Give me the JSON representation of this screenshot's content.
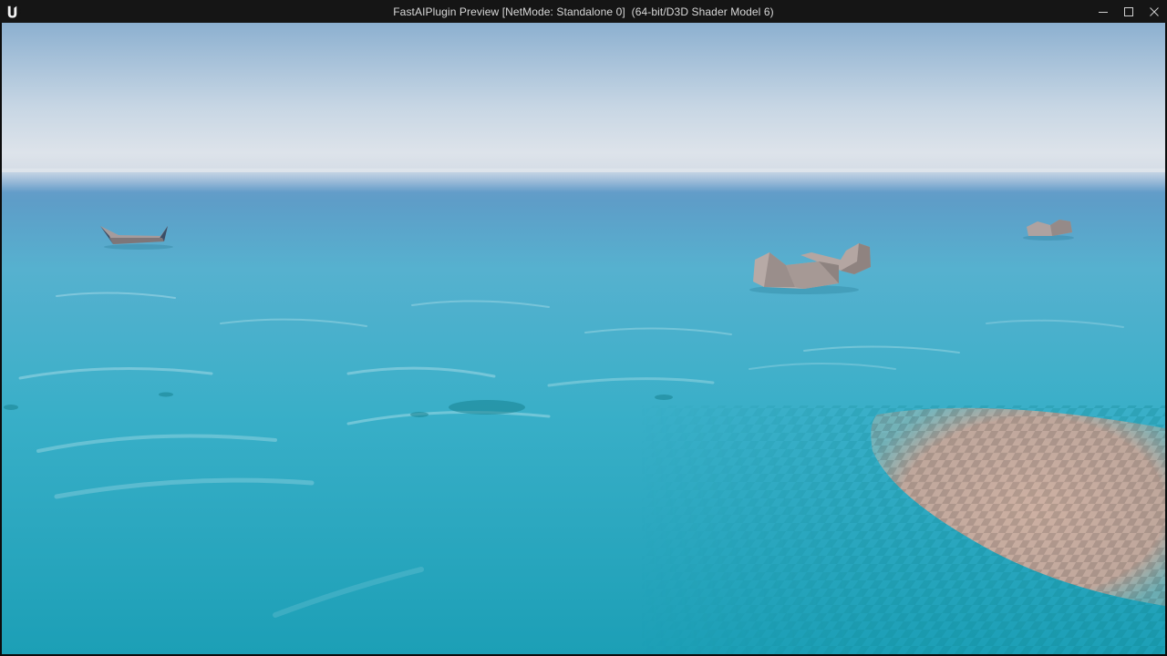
{
  "window": {
    "title": "FastAIPlugin Preview [NetMode: Standalone 0]  (64-bit/D3D Shader Model 6)",
    "app_icon": "unreal-engine-logo",
    "controls": {
      "minimize": "minimize-icon",
      "maximize": "maximize-icon",
      "close": "close-icon"
    }
  },
  "scene": {
    "description_type": "3d-game-viewport",
    "colors": {
      "sky_top": "#8fb3d2",
      "sky_horizon": "#dde3ea",
      "water_far": "#6d9fc9",
      "water_mid": "#3fb0c9",
      "water_near": "#1fa2b9",
      "sand": "#c8a898",
      "rock": "#a89a95"
    }
  }
}
